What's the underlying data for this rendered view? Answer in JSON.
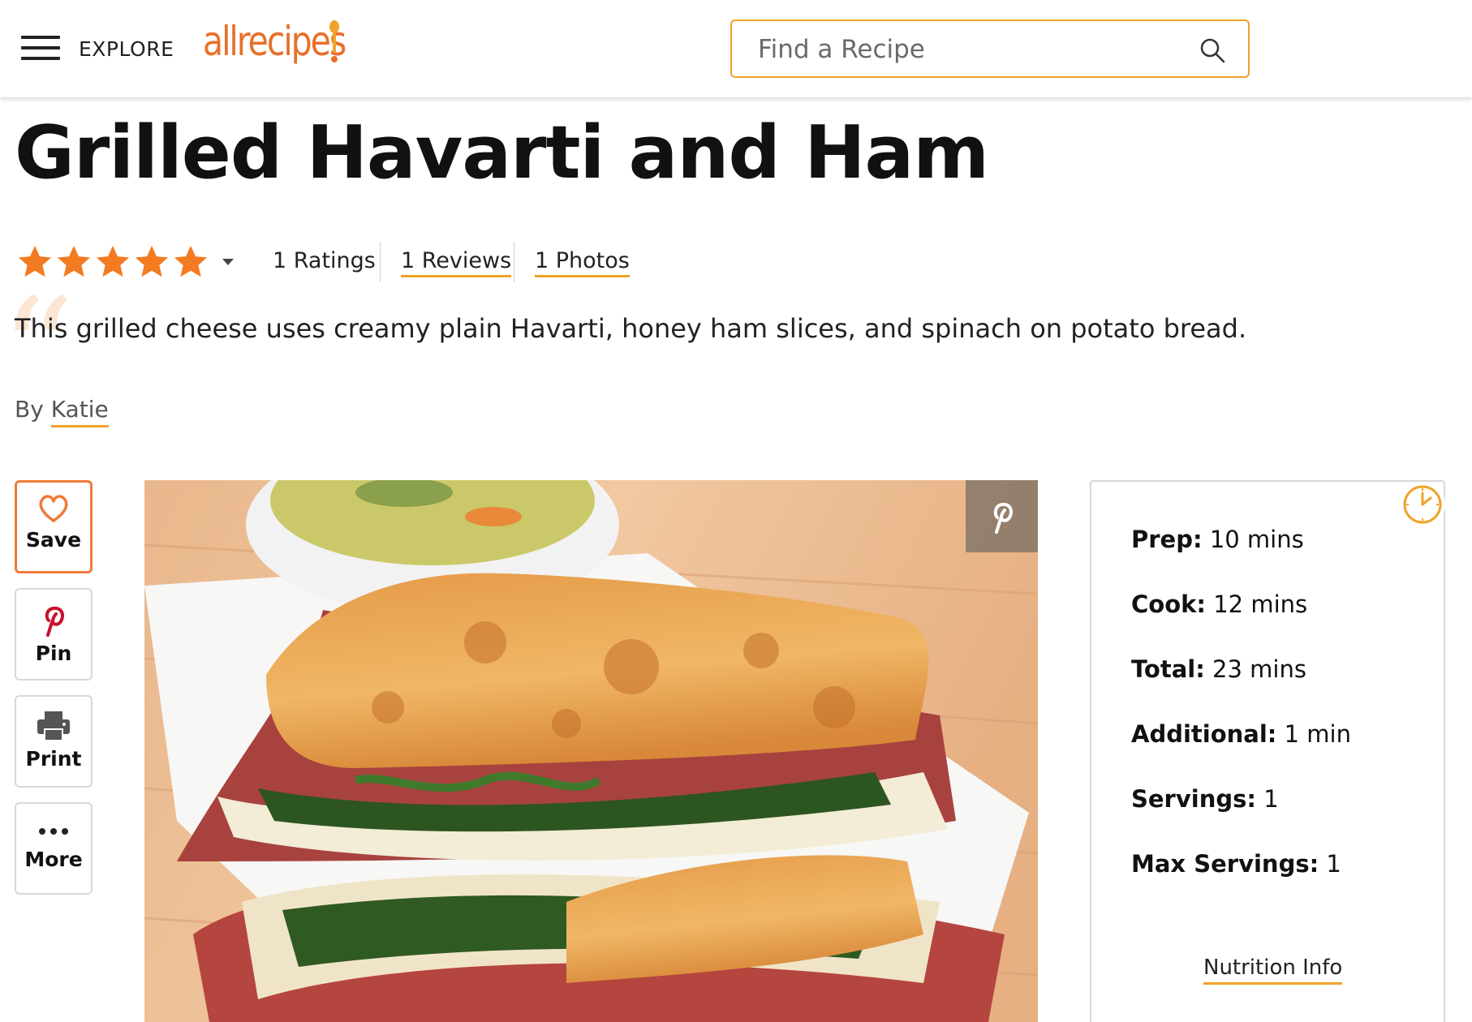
{
  "header": {
    "explore_label": "EXPLORE",
    "logo_text": "allrecipes",
    "search_placeholder": "Find a Recipe",
    "accent_color": "#f0a22a"
  },
  "recipe": {
    "title": "Grilled Havarti and Ham",
    "rating_stars": 5,
    "ratings_label": "1 Ratings",
    "reviews_label": "1 Reviews",
    "photos_label": "1 Photos",
    "description": "This grilled cheese uses creamy plain Havarti, honey ham slices, and spinach on potato bread.",
    "byline_prefix": "By",
    "author": "Katie"
  },
  "actions": [
    {
      "label": "Save",
      "icon": "heart-icon"
    },
    {
      "label": "Pin",
      "icon": "pinterest-icon"
    },
    {
      "label": "Print",
      "icon": "printer-icon"
    },
    {
      "label": "More",
      "icon": "more-dots-icon"
    }
  ],
  "info": {
    "rows": [
      {
        "key": "Prep:",
        "value": "10 mins"
      },
      {
        "key": "Cook:",
        "value": "12 mins"
      },
      {
        "key": "Total:",
        "value": "23 mins"
      },
      {
        "key": "Additional:",
        "value": "1 min"
      },
      {
        "key": "Servings:",
        "value": "1"
      },
      {
        "key": "Max Servings:",
        "value": "1"
      }
    ],
    "nutrition_link": "Nutrition Info"
  }
}
